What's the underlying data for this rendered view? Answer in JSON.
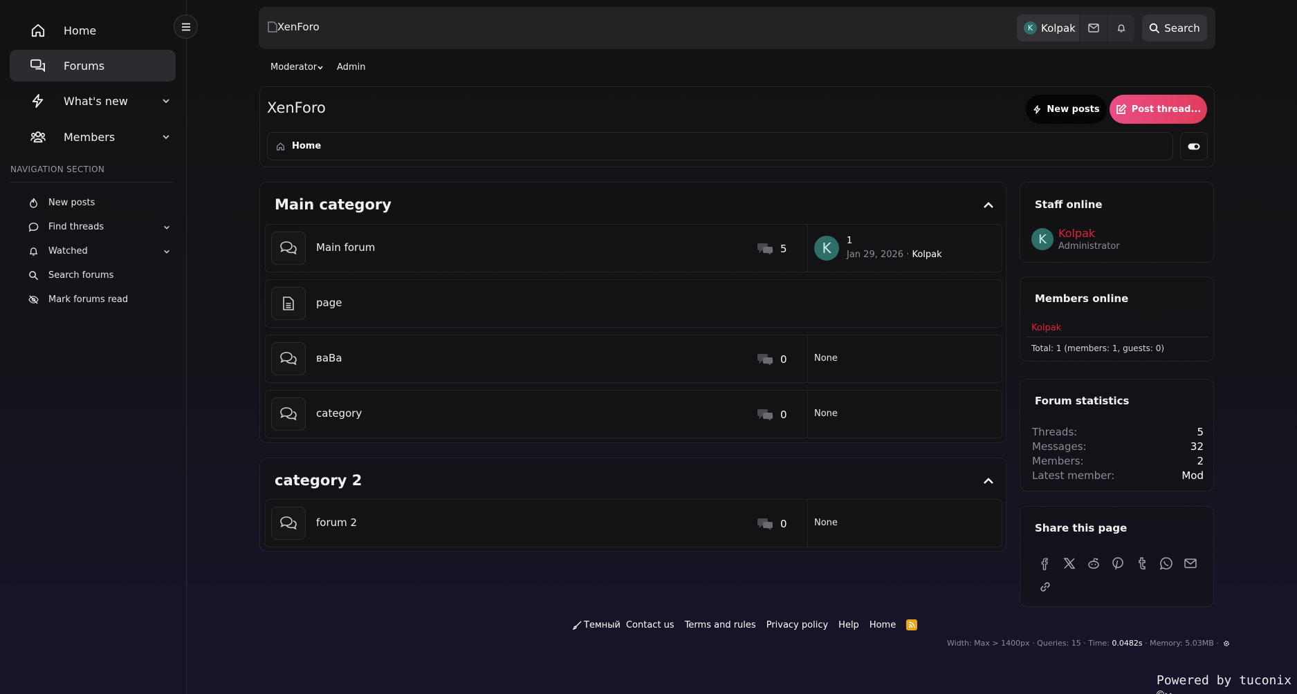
{
  "sidebar": {
    "top": [
      {
        "label": "Home",
        "icon": "home-icon"
      },
      {
        "label": "Forums",
        "icon": "forums-icon",
        "active": true
      },
      {
        "label": "What's new",
        "icon": "bolt-icon"
      },
      {
        "label": "Members",
        "icon": "users-icon"
      }
    ],
    "section_title": "NAVIGATION SECTION",
    "sub": [
      {
        "label": "New posts",
        "icon": "fire-icon"
      },
      {
        "label": "Find threads",
        "icon": "chat-icon"
      },
      {
        "label": "Watched",
        "icon": "bell-icon"
      },
      {
        "label": "Search forums",
        "icon": "search-icon"
      },
      {
        "label": "Mark forums read",
        "icon": "eye-slash-icon"
      }
    ]
  },
  "header": {
    "logo_alt": "XenForo",
    "user": "Kolpak",
    "user_initial": "K",
    "search_label": "Search"
  },
  "subnav": {
    "moderator": "Moderator",
    "admin": "Admin"
  },
  "page": {
    "title": "XenForo",
    "new_posts": "New posts",
    "post_thread": "Post thread...",
    "breadcrumb_home": "Home"
  },
  "categories": [
    {
      "title": "Main category",
      "forums": [
        {
          "name": "Main forum",
          "count": "5",
          "last_title": "1",
          "last_date": "Jan 29, 2026",
          "last_user": "Kolpak",
          "last_initial": "K"
        },
        {
          "name": "page"
        },
        {
          "name": "ваВа",
          "count": "0",
          "last": "None"
        },
        {
          "name": "category",
          "count": "0",
          "last": "None"
        }
      ]
    },
    {
      "title": "category 2",
      "forums": [
        {
          "name": "forum 2",
          "count": "0",
          "last": "None"
        }
      ]
    }
  ],
  "widgets": {
    "staff": {
      "title": "Staff online",
      "user": "Kolpak",
      "role": "Administrator",
      "initial": "K"
    },
    "members": {
      "title": "Members online",
      "user": "Kolpak",
      "total": "Total: 1 (members: 1, guests: 0)"
    },
    "stats": {
      "title": "Forum statistics",
      "rows": [
        {
          "k": "Threads:",
          "v": "5"
        },
        {
          "k": "Messages:",
          "v": "32"
        },
        {
          "k": "Members:",
          "v": "2"
        },
        {
          "k": "Latest member:",
          "v": "Mod"
        }
      ]
    },
    "share": {
      "title": "Share this page"
    }
  },
  "footer": {
    "style": "Темный",
    "links": [
      "Contact us",
      "Terms and rules",
      "Privacy policy",
      "Help",
      "Home"
    ],
    "debug_prefix": "Width: Max > 1400px · Queries: 15 · Time: ",
    "debug_time": "0.0482s",
    "debug_suffix": " · Memory: 5.03MB ·",
    "powered": "Powered by tuconix ©"
  },
  "colors": {
    "accent_red": "#e0203a",
    "post_btn": "#e8467a",
    "avatar": "#2f6d68"
  }
}
